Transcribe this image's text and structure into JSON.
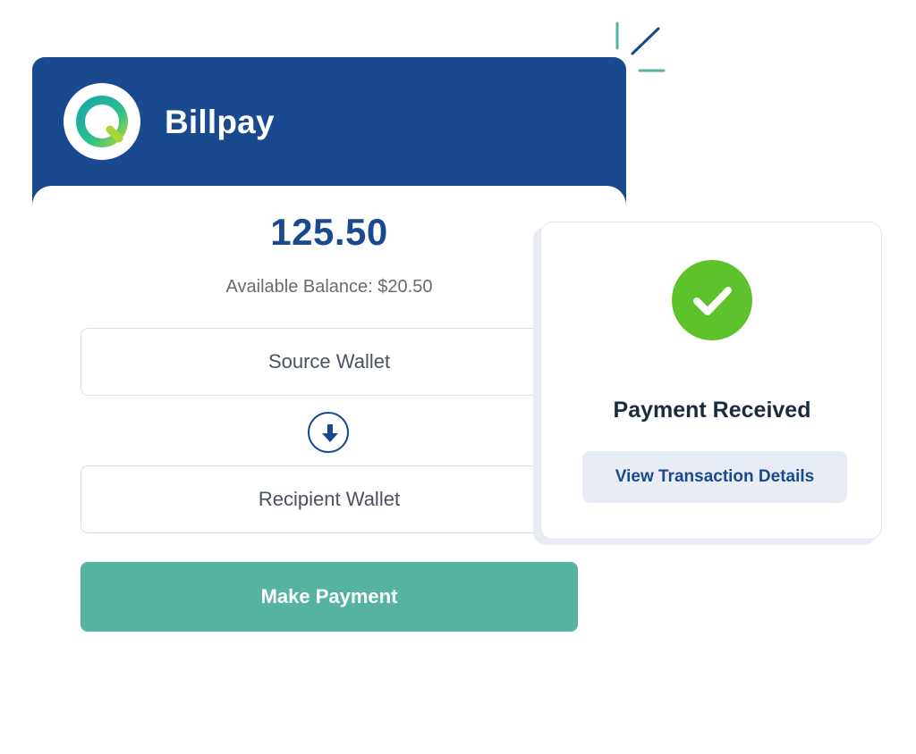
{
  "app": {
    "title": "Billpay",
    "brand_color": "#19498e",
    "accent_color": "#56b3a2"
  },
  "payment": {
    "amount": "125.50",
    "available_balance": "Available Balance: $20.50",
    "source_wallet_label": "Source Wallet",
    "recipient_wallet_label": "Recipient Wallet",
    "make_payment_label": "Make Payment",
    "direction_icon": "arrow-down-icon"
  },
  "popup": {
    "status_icon": "checkmark-icon",
    "status_color": "#5ec22a",
    "title": "Payment Received",
    "details_button_label": "View Transaction Details"
  }
}
